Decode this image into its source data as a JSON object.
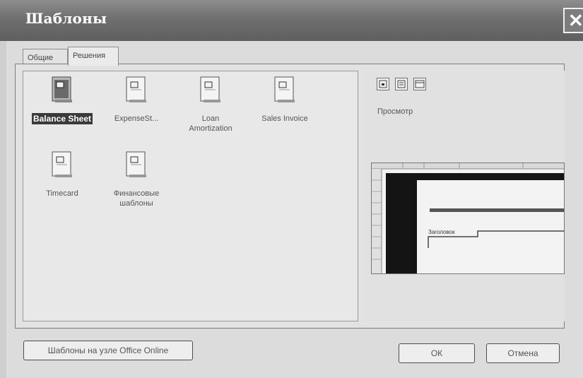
{
  "window": {
    "title": "Шаблоны",
    "close_glyph": "✕"
  },
  "tabs": [
    {
      "label": "Общие",
      "active": false
    },
    {
      "label": "Решения",
      "active": true
    }
  ],
  "templates": [
    {
      "label": "Balance Sheet",
      "selected": true,
      "icon": "spreadsheet-template-icon"
    },
    {
      "label": "ExpenseSt...",
      "selected": false,
      "icon": "spreadsheet-template-icon"
    },
    {
      "label_lines": [
        "Loan",
        "Amortization"
      ],
      "selected": false,
      "icon": "spreadsheet-template-icon"
    },
    {
      "label": "Sales Invoice",
      "selected": false,
      "icon": "spreadsheet-template-icon"
    },
    {
      "label": "Timecard",
      "selected": false,
      "icon": "spreadsheet-template-icon"
    },
    {
      "label_lines": [
        "Финансовые",
        "шаблоны"
      ],
      "selected": false,
      "icon": "spreadsheet-template-icon"
    }
  ],
  "view_buttons": [
    "large-icons-view-icon",
    "list-view-icon",
    "details-view-icon"
  ],
  "preview": {
    "label": "Просмотр",
    "caption": "Заголовок"
  },
  "buttons": {
    "online": "Шаблоны на узле Office Online",
    "ok": "ОК",
    "cancel": "Отмена"
  }
}
